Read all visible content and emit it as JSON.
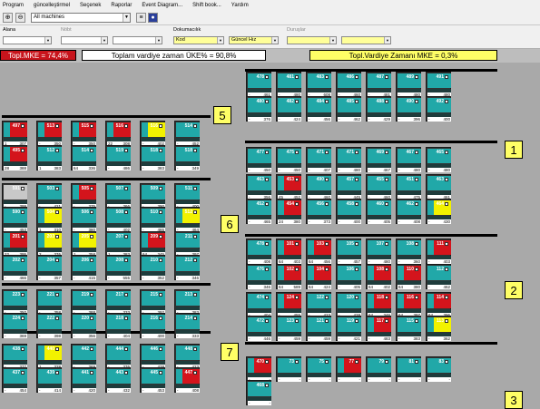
{
  "menu": {
    "items": [
      "Program",
      "güncelleştirmel",
      "Seçenek",
      "Raporlar",
      "Event Diagram...",
      "Shift book...",
      "Yardım"
    ]
  },
  "toolbar": {
    "machine_select": "All machines"
  },
  "filters": {
    "area_label": "Alana",
    "f2_label": "Nöbt",
    "f3_label": "Dokumacılık",
    "f3_value": "Kod",
    "f4_value": "Güncel Hız",
    "f5_label": "Duruşlar"
  },
  "stats": {
    "mke": "Topl.MKE = 74,4%",
    "uke": "Toplam vardiye zaman ÜKE% = 90,8%",
    "shift_mke": "Topl.Vardiye Zamanı MKE = 0,3%"
  },
  "groups": [
    "5",
    "1",
    "6",
    "2",
    "7",
    "3"
  ],
  "machines": [
    {
      "id": "478",
      "st": "t",
      "b": [
        "-",
        "461"
      ]
    },
    {
      "id": "481",
      "st": "t",
      "b": [
        "-",
        "480"
      ]
    },
    {
      "id": "483",
      "st": "t",
      "b": [
        "-",
        "608"
      ]
    },
    {
      "id": "486",
      "st": "t",
      "b": [
        "-",
        "460"
      ]
    },
    {
      "id": "487",
      "st": "t",
      "b": [
        "-",
        "481"
      ]
    },
    {
      "id": "489",
      "st": "t",
      "b": [
        "-",
        "480"
      ]
    },
    {
      "id": "491",
      "st": "t",
      "b": [
        "-",
        "480"
      ]
    },
    {
      "id": "480",
      "st": "t",
      "b": [
        "-",
        "376"
      ]
    },
    {
      "id": "482",
      "st": "t",
      "b": [
        "-",
        "424"
      ]
    },
    {
      "id": "484",
      "st": "t",
      "b": [
        "-",
        "456"
      ]
    },
    {
      "id": "485",
      "st": "t",
      "b": [
        "-",
        "462"
      ]
    },
    {
      "id": "488",
      "st": "t",
      "b": [
        "-",
        "429"
      ]
    },
    {
      "id": "490",
      "st": "t",
      "b": [
        "-",
        "396"
      ]
    },
    {
      "id": "492",
      "st": "t",
      "b": [
        "-",
        "400"
      ]
    },
    {
      "id": "497",
      "st": "r",
      "b": [
        "1",
        "307"
      ]
    },
    {
      "id": "513",
      "st": "r",
      "b": [
        "-",
        "350"
      ]
    },
    {
      "id": "515",
      "st": "r",
      "b": [
        "-",
        "350"
      ]
    },
    {
      "id": "516",
      "st": "r",
      "b": [
        "22",
        "308"
      ]
    },
    {
      "id": "516",
      "st": "y",
      "b": [
        "-",
        "402"
      ]
    },
    {
      "id": "514",
      "st": "t",
      "b": [
        "-",
        "452"
      ]
    },
    {
      "id": "495",
      "st": "r",
      "b": [
        "28",
        "388"
      ]
    },
    {
      "id": "512",
      "st": "t",
      "b": [
        "1",
        "383"
      ]
    },
    {
      "id": "514",
      "st": "t",
      "b": [
        "64",
        "336"
      ]
    },
    {
      "id": "519",
      "st": "t",
      "b": [
        "-",
        "486"
      ]
    },
    {
      "id": "518",
      "st": "t",
      "b": [
        "-",
        "383"
      ]
    },
    {
      "id": "518",
      "st": "t",
      "b": [
        "-",
        "349"
      ]
    },
    {
      "id": "477",
      "st": "t",
      "b": [
        "-",
        "450"
      ]
    },
    {
      "id": "475",
      "st": "t",
      "b": [
        "-",
        "450"
      ]
    },
    {
      "id": "471",
      "st": "t",
      "b": [
        "-",
        "407"
      ]
    },
    {
      "id": "471",
      "st": "t",
      "b": [
        "-",
        "480"
      ]
    },
    {
      "id": "469",
      "st": "t",
      "b": [
        "-",
        "467"
      ]
    },
    {
      "id": "467",
      "st": "t",
      "b": [
        "-",
        "480"
      ]
    },
    {
      "id": "465",
      "st": "t",
      "b": [
        "-",
        "480"
      ]
    },
    {
      "id": "463",
      "st": "t",
      "b": [
        "-",
        "356"
      ]
    },
    {
      "id": "453",
      "st": "r",
      "b": [
        "45",
        "452"
      ]
    },
    {
      "id": "490",
      "st": "t",
      "b": [
        "-",
        "460"
      ]
    },
    {
      "id": "457",
      "st": "t",
      "b": [
        "-",
        "445"
      ]
    },
    {
      "id": "455",
      "st": "t",
      "b": [
        "-",
        "460"
      ]
    },
    {
      "id": "451",
      "st": "t",
      "b": [
        "-",
        "475"
      ]
    },
    {
      "id": "463",
      "st": "t",
      "b": [
        "-",
        "461"
      ]
    },
    {
      "id": "452",
      "st": "t",
      "b": [
        "-",
        "465"
      ]
    },
    {
      "id": "454",
      "st": "r",
      "b": [
        "24",
        "380"
      ]
    },
    {
      "id": "456",
      "st": "t",
      "b": [
        "-",
        "373"
      ]
    },
    {
      "id": "458",
      "st": "t",
      "b": [
        "-",
        "400"
      ]
    },
    {
      "id": "460",
      "st": "t",
      "b": [
        "-",
        "405"
      ]
    },
    {
      "id": "462",
      "st": "t",
      "b": [
        "-",
        "408"
      ]
    },
    {
      "id": "464",
      "st": "y",
      "b": [
        "-",
        "430"
      ]
    },
    {
      "id": "591",
      "st": "g",
      "b": [
        "-",
        "399"
      ]
    },
    {
      "id": "503",
      "st": "t",
      "b": [
        "-",
        "421"
      ]
    },
    {
      "id": "505",
      "st": "r",
      "b": [
        "-",
        "375"
      ]
    },
    {
      "id": "507",
      "st": "t",
      "b": [
        "-",
        "366"
      ]
    },
    {
      "id": "509",
      "st": "t",
      "b": [
        "-",
        "390"
      ]
    },
    {
      "id": "511",
      "st": "t",
      "b": [
        "-",
        "400"
      ]
    },
    {
      "id": "590",
      "st": "t",
      "b": [
        "-",
        "453"
      ]
    },
    {
      "id": "504",
      "st": "y",
      "b": [
        "1",
        "310"
      ]
    },
    {
      "id": "506",
      "st": "t",
      "b": [
        "-",
        "380"
      ]
    },
    {
      "id": "508",
      "st": "t",
      "b": [
        "-",
        "402"
      ]
    },
    {
      "id": "510",
      "st": "t",
      "b": [
        "-",
        "465"
      ]
    },
    {
      "id": "512",
      "st": "y",
      "b": [
        "-",
        "464"
      ]
    },
    {
      "id": "201",
      "st": "r",
      "b": [
        "22",
        "395"
      ]
    },
    {
      "id": "203",
      "st": "y",
      "b": [
        "2",
        "376"
      ]
    },
    {
      "id": "205",
      "st": "y",
      "b": [
        "1",
        "358"
      ]
    },
    {
      "id": "207",
      "st": "t",
      "b": [
        "1",
        "383"
      ]
    },
    {
      "id": "209",
      "st": "r",
      "b": [
        "64",
        "345"
      ]
    },
    {
      "id": "211",
      "st": "t",
      "b": [
        "-",
        "397"
      ]
    },
    {
      "id": "202",
      "st": "t",
      "b": [
        "-",
        "466"
      ]
    },
    {
      "id": "204",
      "st": "t",
      "b": [
        "-",
        "357"
      ]
    },
    {
      "id": "206",
      "st": "t",
      "b": [
        "-",
        "415"
      ]
    },
    {
      "id": "208",
      "st": "t",
      "b": [
        "-",
        "555"
      ]
    },
    {
      "id": "210",
      "st": "t",
      "b": [
        "-",
        "352"
      ]
    },
    {
      "id": "212",
      "st": "t",
      "b": [
        "-",
        "346"
      ]
    },
    {
      "id": "478",
      "st": "t",
      "b": [
        "-",
        "408"
      ]
    },
    {
      "id": "101",
      "st": "r",
      "b": [
        "64",
        "403"
      ]
    },
    {
      "id": "103",
      "st": "r",
      "b": [
        "64",
        "456"
      ]
    },
    {
      "id": "105",
      "st": "t",
      "b": [
        "-",
        "457"
      ]
    },
    {
      "id": "107",
      "st": "t",
      "b": [
        "-",
        "480"
      ]
    },
    {
      "id": "108",
      "st": "t",
      "b": [
        "-",
        "360"
      ]
    },
    {
      "id": "111",
      "st": "r",
      "b": [
        "-",
        "403"
      ]
    },
    {
      "id": "476",
      "st": "t",
      "b": [
        "-",
        "346"
      ]
    },
    {
      "id": "102",
      "st": "r",
      "b": [
        "64",
        "589"
      ]
    },
    {
      "id": "104",
      "st": "r",
      "b": [
        "64",
        "424"
      ]
    },
    {
      "id": "106",
      "st": "t",
      "b": [
        "-",
        "405"
      ]
    },
    {
      "id": "108",
      "st": "r",
      "b": [
        "64",
        "402"
      ]
    },
    {
      "id": "110",
      "st": "r",
      "b": [
        "64",
        "380"
      ]
    },
    {
      "id": "112",
      "st": "t",
      "b": [
        "-",
        "462"
      ]
    },
    {
      "id": "474",
      "st": "t",
      "b": [
        "-",
        "404"
      ]
    },
    {
      "id": "124",
      "st": "r",
      "b": [
        "-",
        "455"
      ]
    },
    {
      "id": "122",
      "st": "t",
      "b": [
        "-",
        "423"
      ]
    },
    {
      "id": "120",
      "st": "t",
      "b": [
        "-",
        "428"
      ]
    },
    {
      "id": "118",
      "st": "r",
      "b": [
        "64",
        "346"
      ]
    },
    {
      "id": "116",
      "st": "r",
      "b": [
        "64",
        "397"
      ]
    },
    {
      "id": "114",
      "st": "r",
      "b": [
        "64",
        "396"
      ]
    },
    {
      "id": "472",
      "st": "t",
      "b": [
        "-",
        "446"
      ]
    },
    {
      "id": "123",
      "st": "t",
      "b": [
        "-",
        "459"
      ]
    },
    {
      "id": "121",
      "st": "t",
      "b": [
        "-",
        "459"
      ]
    },
    {
      "id": "119",
      "st": "t",
      "b": [
        "-",
        "421"
      ]
    },
    {
      "id": "117",
      "st": "r",
      "b": [
        "-",
        "483"
      ]
    },
    {
      "id": "115",
      "st": "t",
      "b": [
        "-",
        "383"
      ]
    },
    {
      "id": "113",
      "st": "y",
      "b": [
        "-",
        "362"
      ]
    },
    {
      "id": "223",
      "st": "t",
      "b": [
        "-",
        "350"
      ]
    },
    {
      "id": "221",
      "st": "t",
      "b": [
        "-",
        "358"
      ]
    },
    {
      "id": "219",
      "st": "t",
      "b": [
        "-",
        "388"
      ]
    },
    {
      "id": "217",
      "st": "t",
      "b": [
        "-",
        "333"
      ]
    },
    {
      "id": "215",
      "st": "t",
      "b": [
        "-",
        "392"
      ]
    },
    {
      "id": "213",
      "st": "t",
      "b": [
        "-",
        "383"
      ]
    },
    {
      "id": "224",
      "st": "t",
      "b": [
        "-",
        "369"
      ]
    },
    {
      "id": "222",
      "st": "t",
      "b": [
        "-",
        "398"
      ]
    },
    {
      "id": "220",
      "st": "t",
      "b": [
        "-",
        "356"
      ]
    },
    {
      "id": "218",
      "st": "t",
      "b": [
        "-",
        "404"
      ]
    },
    {
      "id": "216",
      "st": "t",
      "b": [
        "-",
        "400"
      ]
    },
    {
      "id": "214",
      "st": "t",
      "b": [
        "-",
        "333"
      ]
    },
    {
      "id": "438",
      "st": "t",
      "b": [
        "-",
        "377"
      ]
    },
    {
      "id": "440",
      "st": "y",
      "b": [
        "1",
        "328"
      ]
    },
    {
      "id": "442",
      "st": "t",
      "b": [
        "-",
        "369"
      ]
    },
    {
      "id": "444",
      "st": "t",
      "b": [
        "-",
        "376"
      ]
    },
    {
      "id": "446",
      "st": "t",
      "b": [
        "-",
        "428"
      ]
    },
    {
      "id": "448",
      "st": "t",
      "b": [
        "-",
        "423"
      ]
    },
    {
      "id": "437",
      "st": "t",
      "b": [
        "-",
        "454"
      ]
    },
    {
      "id": "439",
      "st": "t",
      "b": [
        "-",
        "414"
      ]
    },
    {
      "id": "441",
      "st": "t",
      "b": [
        "-",
        "420"
      ]
    },
    {
      "id": "443",
      "st": "t",
      "b": [
        "-",
        "432"
      ]
    },
    {
      "id": "445",
      "st": "t",
      "b": [
        "-",
        "453"
      ]
    },
    {
      "id": "447",
      "st": "r",
      "b": [
        "-",
        "408"
      ]
    },
    {
      "id": "470",
      "st": "r",
      "b": [
        "-",
        "-"
      ]
    },
    {
      "id": "73",
      "st": "t",
      "b": [
        "-",
        "-"
      ]
    },
    {
      "id": "75",
      "st": "t",
      "b": [
        "-",
        "-"
      ]
    },
    {
      "id": "77",
      "st": "r",
      "b": [
        "-",
        "-"
      ]
    },
    {
      "id": "79",
      "st": "t",
      "b": [
        "-",
        "-"
      ]
    },
    {
      "id": "81",
      "st": "t",
      "b": [
        "-",
        "-"
      ]
    },
    {
      "id": "83",
      "st": "t",
      "b": [
        "-",
        "-"
      ]
    },
    {
      "id": "468",
      "st": "t",
      "b": [
        "-",
        "-"
      ]
    }
  ]
}
